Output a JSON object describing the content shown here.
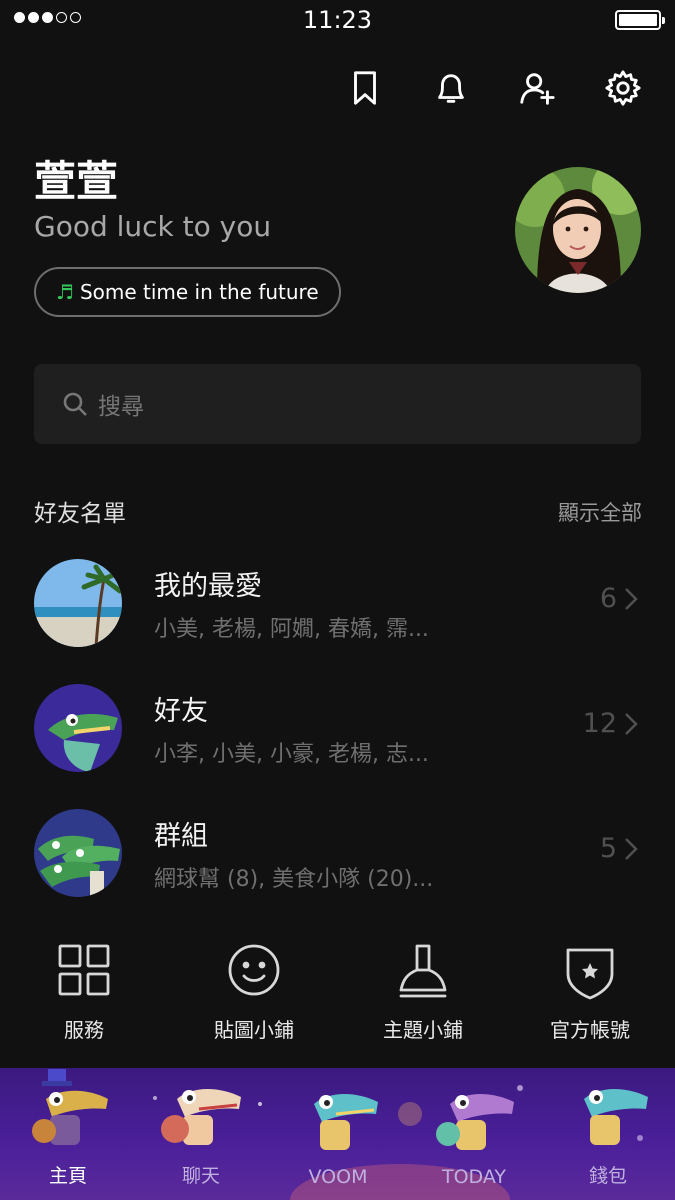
{
  "status_bar": {
    "time": "11:23",
    "signal_filled": 3,
    "signal_total": 5
  },
  "header_icons": [
    "bookmark-icon",
    "bell-icon",
    "add-friend-icon",
    "gear-icon"
  ],
  "profile": {
    "name": "萱萱",
    "status_message": "Good luck to you",
    "music": "Some time in the future"
  },
  "search": {
    "placeholder": "搜尋"
  },
  "friends_section": {
    "title": "好友名單",
    "show_all": "顯示全部",
    "groups": [
      {
        "title": "我的最愛",
        "members": "小美, 老楊, 阿嫺, 春嬌, 霈...",
        "count": "6"
      },
      {
        "title": "好友",
        "members": "小李, 小美, 小豪, 老楊, 志...",
        "count": "12"
      },
      {
        "title": "群組",
        "members": "網球幫 (8), 美食小隊 (20)...",
        "count": "5"
      }
    ]
  },
  "services": [
    {
      "label": "服務",
      "icon": "grid-icon"
    },
    {
      "label": "貼圖小鋪",
      "icon": "smiley-icon"
    },
    {
      "label": "主題小鋪",
      "icon": "brush-icon"
    },
    {
      "label": "官方帳號",
      "icon": "shield-star-icon"
    }
  ],
  "tab_bar": {
    "tabs": [
      {
        "label": "主頁",
        "active": true
      },
      {
        "label": "聊天",
        "active": false
      },
      {
        "label": "VOOM",
        "active": false
      },
      {
        "label": "TODAY",
        "active": false
      },
      {
        "label": "錢包",
        "active": false
      }
    ]
  },
  "colors": {
    "background": "#111111",
    "accent_green": "#35c759",
    "tabbar": "#4a1f99"
  }
}
